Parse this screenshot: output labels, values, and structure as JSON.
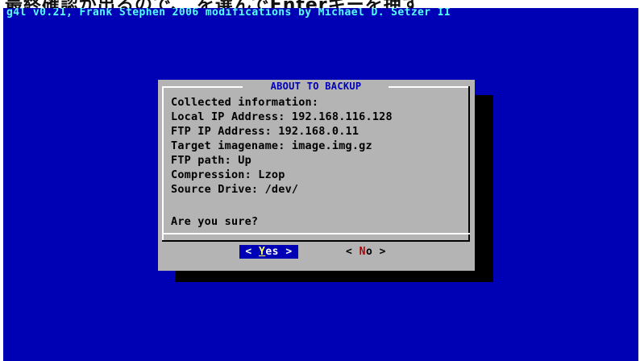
{
  "caption": {
    "partial_text": "最終確認が出るので、  を選んでEnterキーを押す"
  },
  "terminal": {
    "header": "g4l v0.21, Frank Stephen 2006 modifications by Michael D. Setzer II"
  },
  "dialog": {
    "title": "ABOUT TO BACKUP",
    "lines": [
      "Collected information:",
      "Local IP Address: 192.168.116.128",
      "FTP IP Address: 192.168.0.11",
      "Target imagename: image.img.gz",
      "FTP path: Up",
      "Compression: Lzop",
      "Source Drive: /dev/"
    ],
    "question": "Are you sure?",
    "buttons": {
      "yes": {
        "left": "<",
        "hotkey": "Y",
        "rest": "es",
        "right": ">"
      },
      "no": {
        "left": "<",
        "hotkey": "N",
        "rest": "o",
        "right": ">"
      }
    }
  },
  "colors": {
    "background": "#0000b4",
    "dialog": "#b4b4b4",
    "header_text": "#55ffff",
    "title_text": "#0000b4",
    "selected_button_bg": "#0000b4",
    "hotkey_selected": "#ffff55",
    "hotkey_unselected": "#b40000"
  }
}
